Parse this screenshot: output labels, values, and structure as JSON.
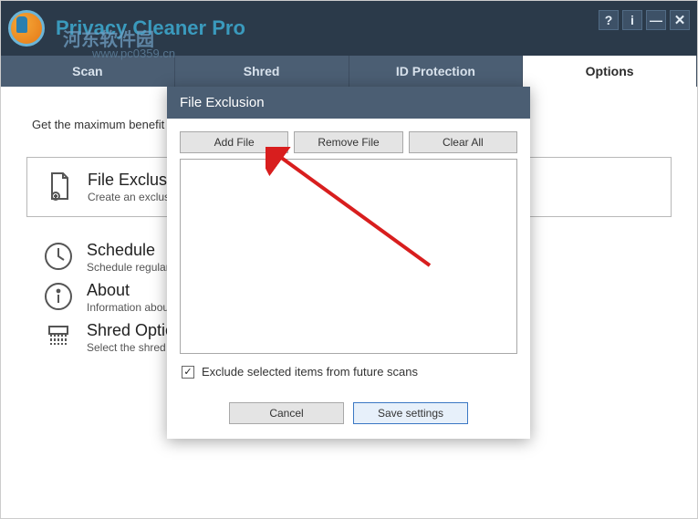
{
  "app": {
    "title": "Privacy Cleaner Pro",
    "watermark_cn": "河东软件园",
    "watermark_url": "www.pc0359.cn"
  },
  "window_buttons": {
    "help": "?",
    "info": "i",
    "min": "—",
    "close": "✕"
  },
  "tabs": [
    {
      "label": "Scan",
      "active": false
    },
    {
      "label": "Shred",
      "active": false
    },
    {
      "label": "ID Protection",
      "active": false
    },
    {
      "label": "Options",
      "active": true
    }
  ],
  "intro": "Get the maximum benefit by setting various options as per your needs",
  "options": [
    {
      "title": "File Exclusion",
      "desc": "Create an exclusion list"
    },
    {
      "title": "Schedule",
      "desc": "Schedule regular scans"
    },
    {
      "title": "About",
      "desc": "Information about"
    },
    {
      "title": "Shred Options",
      "desc": "Select the shred level that best suits your information"
    }
  ],
  "modal": {
    "title": "File Exclusion",
    "add": "Add File",
    "remove": "Remove File",
    "clear": "Clear All",
    "checkbox": "Exclude selected items from future scans",
    "checked": true,
    "cancel": "Cancel",
    "save": "Save settings"
  }
}
